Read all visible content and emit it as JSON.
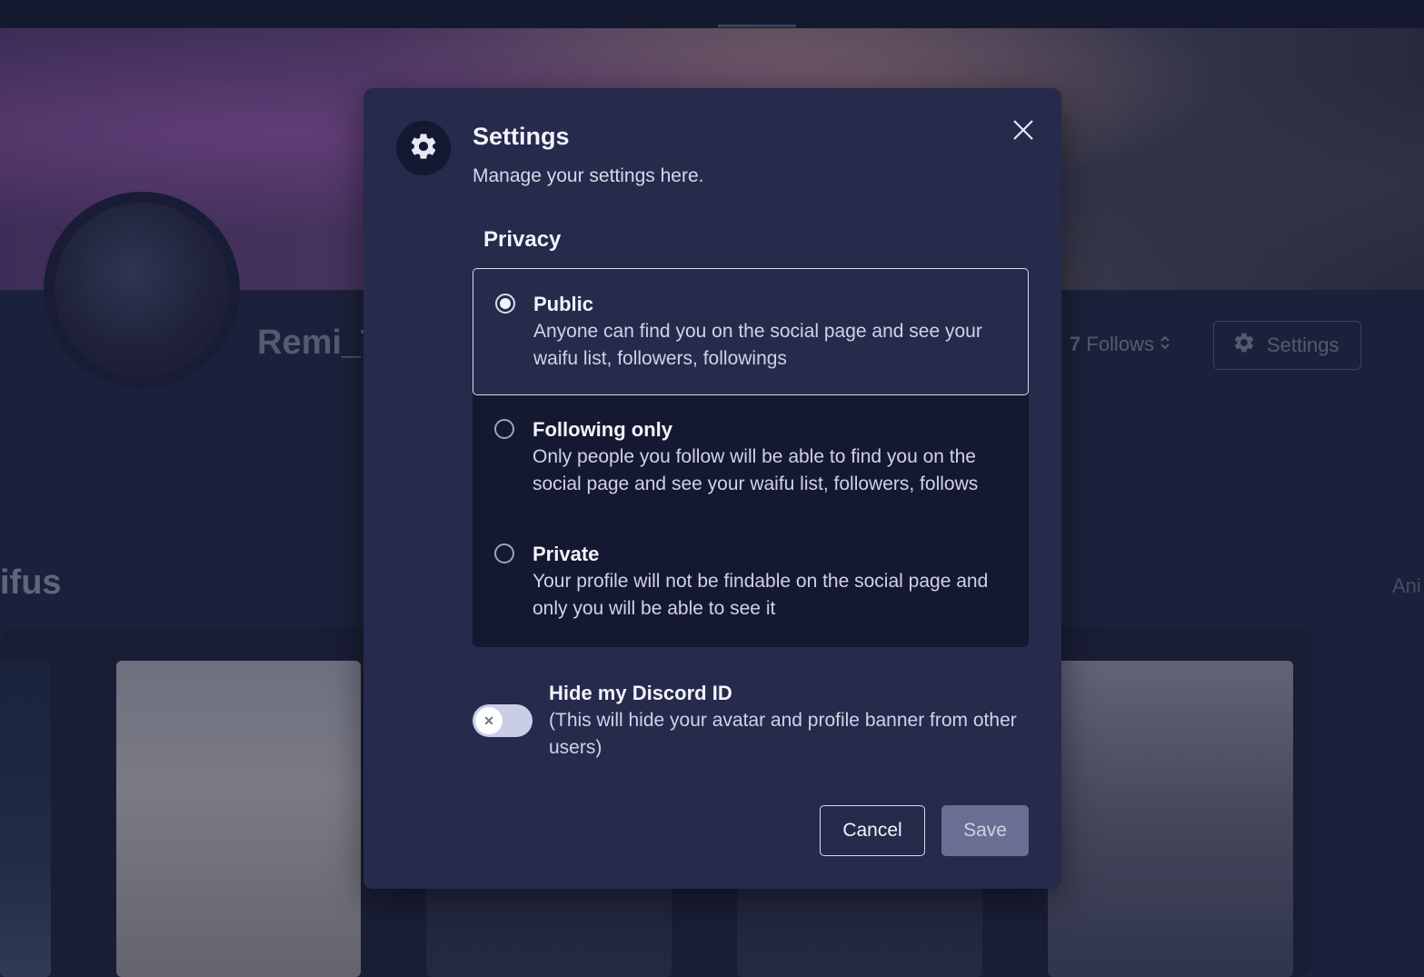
{
  "background": {
    "username": "Remi_T",
    "follows_count": "7",
    "follows_label": "Follows",
    "settings_label": "Settings",
    "section_title": "ifus",
    "side_link": "Ani"
  },
  "modal": {
    "title": "Settings",
    "subtitle": "Manage your settings here.",
    "privacy_heading": "Privacy",
    "options": [
      {
        "title": "Public",
        "description": "Anyone can find you on the social page and see your waifu list, followers, followings",
        "selected": true
      },
      {
        "title": "Following only",
        "description": "Only people you follow will be able to find you on the social page and see your waifu list, followers, follows",
        "selected": false
      },
      {
        "title": "Private",
        "description": "Your profile will not be findable on the social page and only you will be able to see it",
        "selected": false
      }
    ],
    "discord_toggle": {
      "title": "Hide my Discord ID",
      "description": "(This will hide your avatar and profile banner from other users)",
      "enabled": false
    },
    "cancel_label": "Cancel",
    "save_label": "Save"
  },
  "colors": {
    "page_bg": "#1f2440",
    "modal_bg": "#262a4b",
    "options_bg": "#141830",
    "save_bg": "#6a6e93"
  },
  "icons": [
    "gear-icon",
    "close-icon",
    "chevron-updown-icon",
    "x-icon"
  ]
}
